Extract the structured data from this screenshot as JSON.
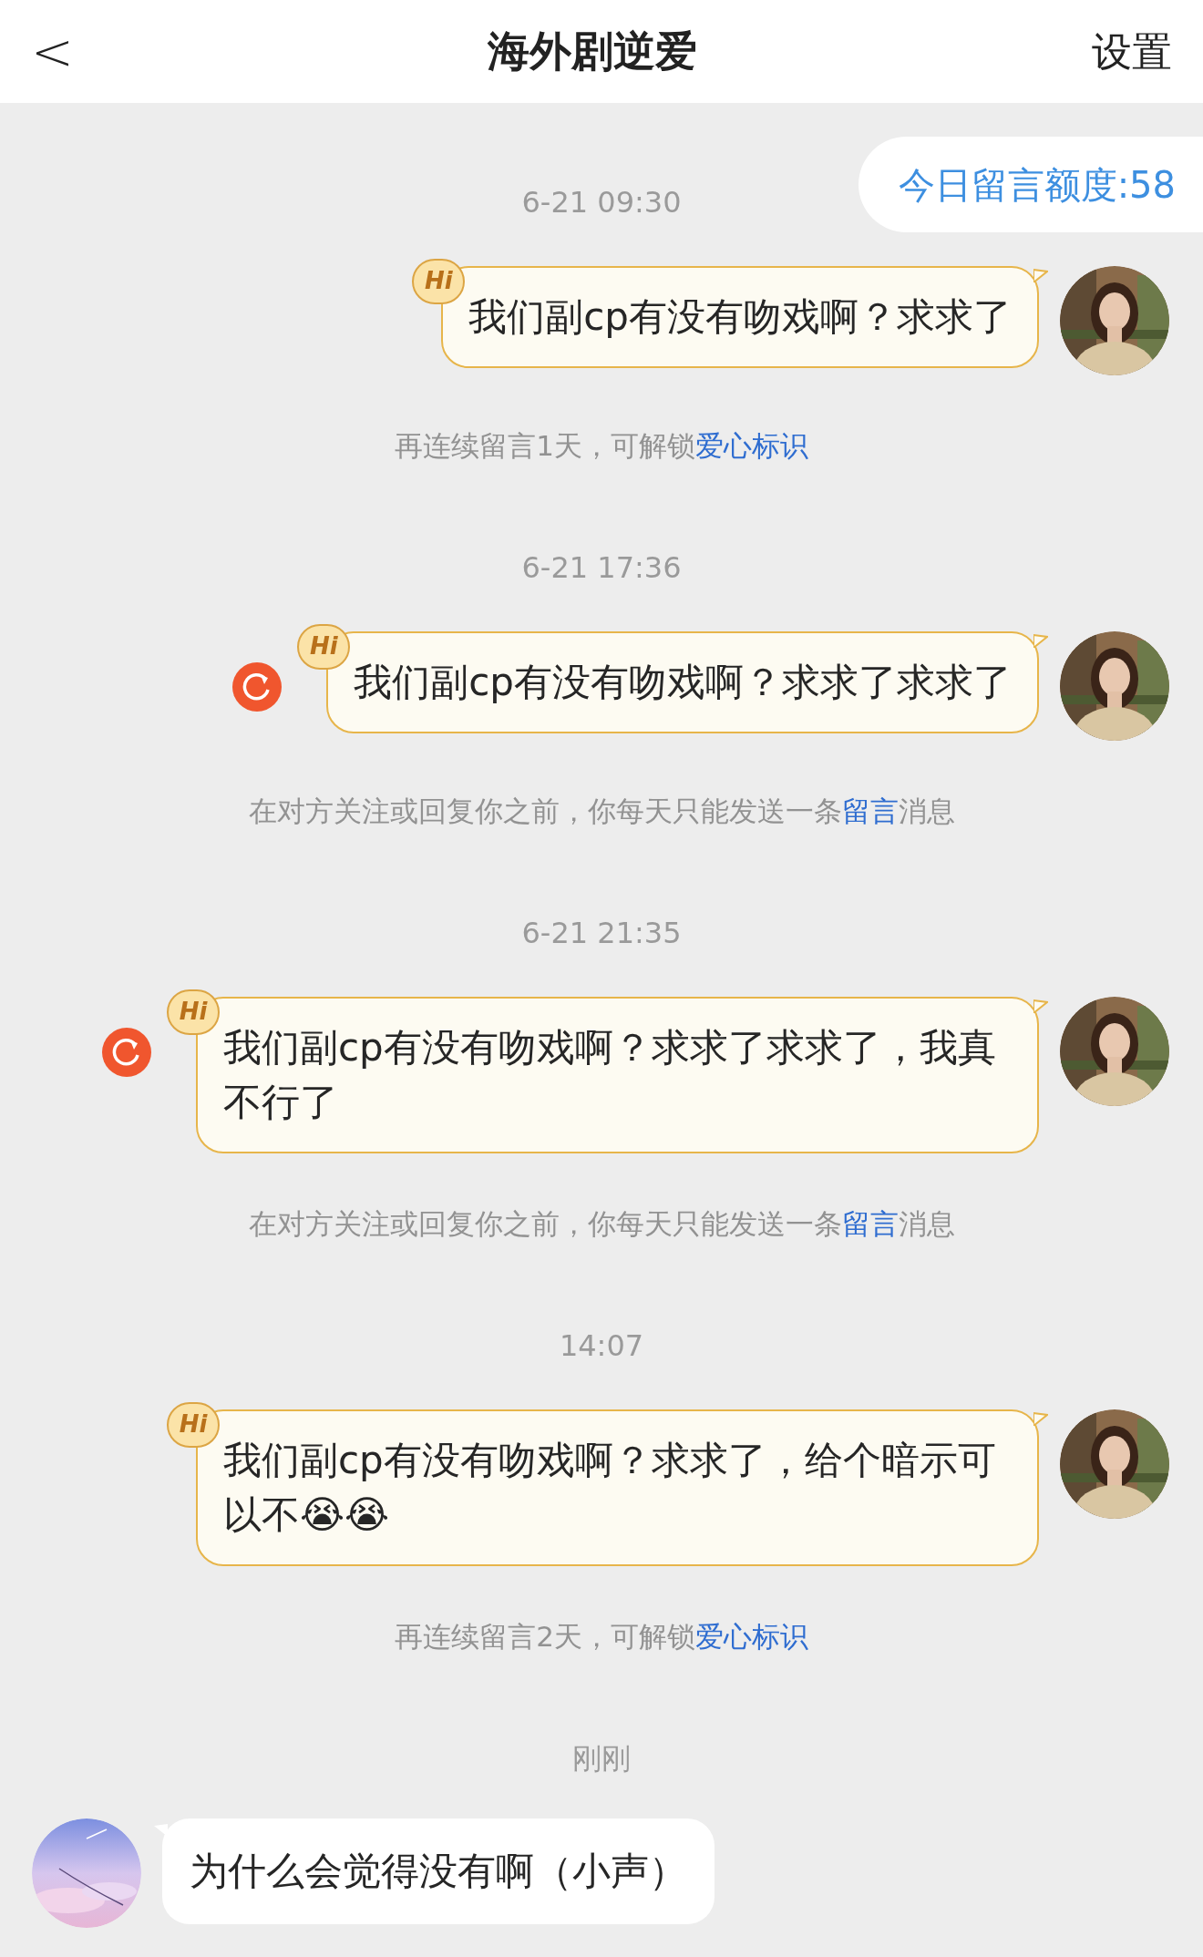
{
  "header": {
    "back": "<",
    "title": "海外剧逆爱",
    "settings": "设置"
  },
  "quota": "今日留言额度:58",
  "sections": [
    {
      "time": "6-21 09:30",
      "message": {
        "kind": "sent",
        "badge": "Hi",
        "failed": false,
        "text": "我们副cp有没有吻戏啊？求求了"
      },
      "notice": {
        "before": "再连续留言1天，可解锁",
        "link": "爱心标识"
      }
    },
    {
      "time": "6-21 17:36",
      "message": {
        "kind": "sent",
        "badge": "Hi",
        "failed": true,
        "text": "我们副cp有没有吻戏啊？求求了求求了"
      },
      "notice": {
        "before": "在对方关注或回复你之前，你每天只能发送一条",
        "link": "留言",
        "after": "消息"
      }
    },
    {
      "time": "6-21 21:35",
      "message": {
        "kind": "sent",
        "badge": "Hi",
        "failed": true,
        "text": "我们副cp有没有吻戏啊？求求了求求了，我真不行了"
      },
      "notice": {
        "before": "在对方关注或回复你之前，你每天只能发送一条",
        "link": "留言",
        "after": "消息"
      }
    },
    {
      "time": "14:07",
      "message": {
        "kind": "sent",
        "badge": "Hi",
        "failed": false,
        "text": "我们副cp有没有吻戏啊？求求了，给个暗示可以不😭😭"
      },
      "notice": {
        "before": "再连续留言2天，可解锁",
        "link": "爱心标识"
      }
    },
    {
      "time": "刚刚",
      "message": {
        "kind": "received",
        "text": "为什么会觉得没有啊（小声）"
      }
    }
  ]
}
